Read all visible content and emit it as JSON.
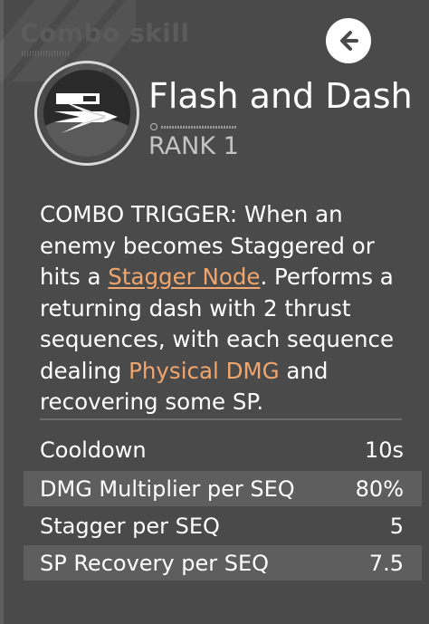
{
  "header": {
    "section_label": "Combo skill"
  },
  "skill": {
    "name": "Flash and Dash",
    "rank": "RANK 1",
    "icon": "flash-dash-icon"
  },
  "description": {
    "part1": "COMBO TRIGGER: When an enemy becomes Staggered or hits a ",
    "link": "Stagger Node",
    "part2": ". Performs a returning dash with 2 thrust sequences, with each sequence dealing ",
    "dmg_type": "Physical DMG",
    "part3": " and recovering some SP."
  },
  "stats": [
    {
      "label": "Cooldown",
      "value": "10s"
    },
    {
      "label": "DMG Multiplier per SEQ",
      "value": "80%"
    },
    {
      "label": "Stagger per SEQ",
      "value": "5"
    },
    {
      "label": "SP Recovery per SEQ",
      "value": "7.5"
    }
  ],
  "colors": {
    "background": "#4a4a4b",
    "accent": "#f0a66c",
    "shaded_row": "#5e5e5f"
  }
}
